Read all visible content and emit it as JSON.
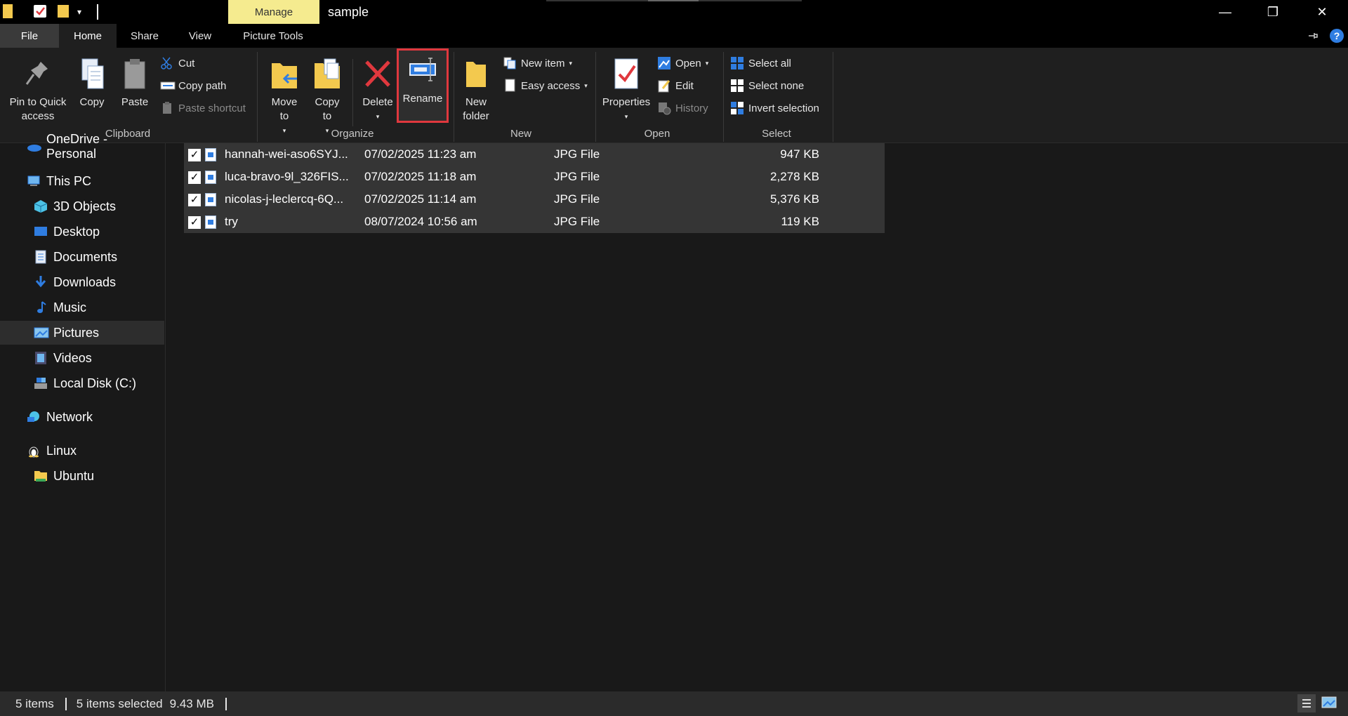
{
  "titlebar": {
    "manage_label": "Manage",
    "window_title": "sample",
    "minimize_glyph": "—",
    "restore_glyph": "❐",
    "close_glyph": "✕"
  },
  "ribbon_tabs": {
    "file": "File",
    "home": "Home",
    "share": "Share",
    "view": "View",
    "picture_tools": "Picture Tools",
    "help_glyph": "?"
  },
  "ribbon": {
    "clipboard": {
      "pin_label": "Pin to Quick access",
      "copy_label": "Copy",
      "paste_label": "Paste",
      "cut_label": "Cut",
      "copy_path_label": "Copy path",
      "paste_shortcut_label": "Paste shortcut",
      "group_label": "Clipboard"
    },
    "organize": {
      "move_to_label": "Move to",
      "copy_to_label": "Copy to",
      "delete_label": "Delete",
      "rename_label": "Rename",
      "group_label": "Organize"
    },
    "new": {
      "new_folder_label": "New folder",
      "new_item_label": "New item",
      "easy_access_label": "Easy access",
      "group_label": "New"
    },
    "open": {
      "properties_label": "Properties",
      "open_label": "Open",
      "edit_label": "Edit",
      "history_label": "History",
      "group_label": "Open"
    },
    "select": {
      "select_all_label": "Select all",
      "select_none_label": "Select none",
      "invert_selection_label": "Invert selection",
      "group_label": "Select"
    }
  },
  "sidebar": {
    "items": [
      {
        "label": "OneDrive - Personal",
        "icon": "cloud-icon"
      },
      {
        "label": "This PC",
        "icon": "computer-icon"
      },
      {
        "label": "3D Objects",
        "icon": "cube-icon"
      },
      {
        "label": "Desktop",
        "icon": "desktop-icon"
      },
      {
        "label": "Documents",
        "icon": "document-icon"
      },
      {
        "label": "Downloads",
        "icon": "download-icon"
      },
      {
        "label": "Music",
        "icon": "music-icon"
      },
      {
        "label": "Pictures",
        "icon": "pictures-icon"
      },
      {
        "label": "Videos",
        "icon": "video-icon"
      },
      {
        "label": "Local Disk (C:)",
        "icon": "disk-icon"
      },
      {
        "label": "Network",
        "icon": "network-icon"
      },
      {
        "label": "Linux",
        "icon": "linux-icon"
      },
      {
        "label": "Ubuntu",
        "icon": "folder-icon"
      }
    ]
  },
  "files": [
    {
      "name": "hannah-wei-aso6SYJ...",
      "date": "07/02/2025 11:23 am",
      "type": "JPG File",
      "size": "947 KB",
      "checked": true
    },
    {
      "name": "luca-bravo-9l_326FIS...",
      "date": "07/02/2025 11:18 am",
      "type": "JPG File",
      "size": "2,278 KB",
      "checked": true
    },
    {
      "name": "nicolas-j-leclercq-6Q...",
      "date": "07/02/2025 11:14 am",
      "type": "JPG File",
      "size": "5,376 KB",
      "checked": true
    },
    {
      "name": "try",
      "date": "08/07/2024 10:56 am",
      "type": "JPG File",
      "size": "119 KB",
      "checked": true
    }
  ],
  "statusbar": {
    "items_count": "5 items",
    "selected_count": "5 items selected",
    "selected_size": "9.43 MB"
  },
  "colors": {
    "highlight_outline": "#e0383e",
    "manage_tab": "#f5eb8f",
    "folder": "#f3c94e",
    "accent_blue": "#2f7de1"
  }
}
